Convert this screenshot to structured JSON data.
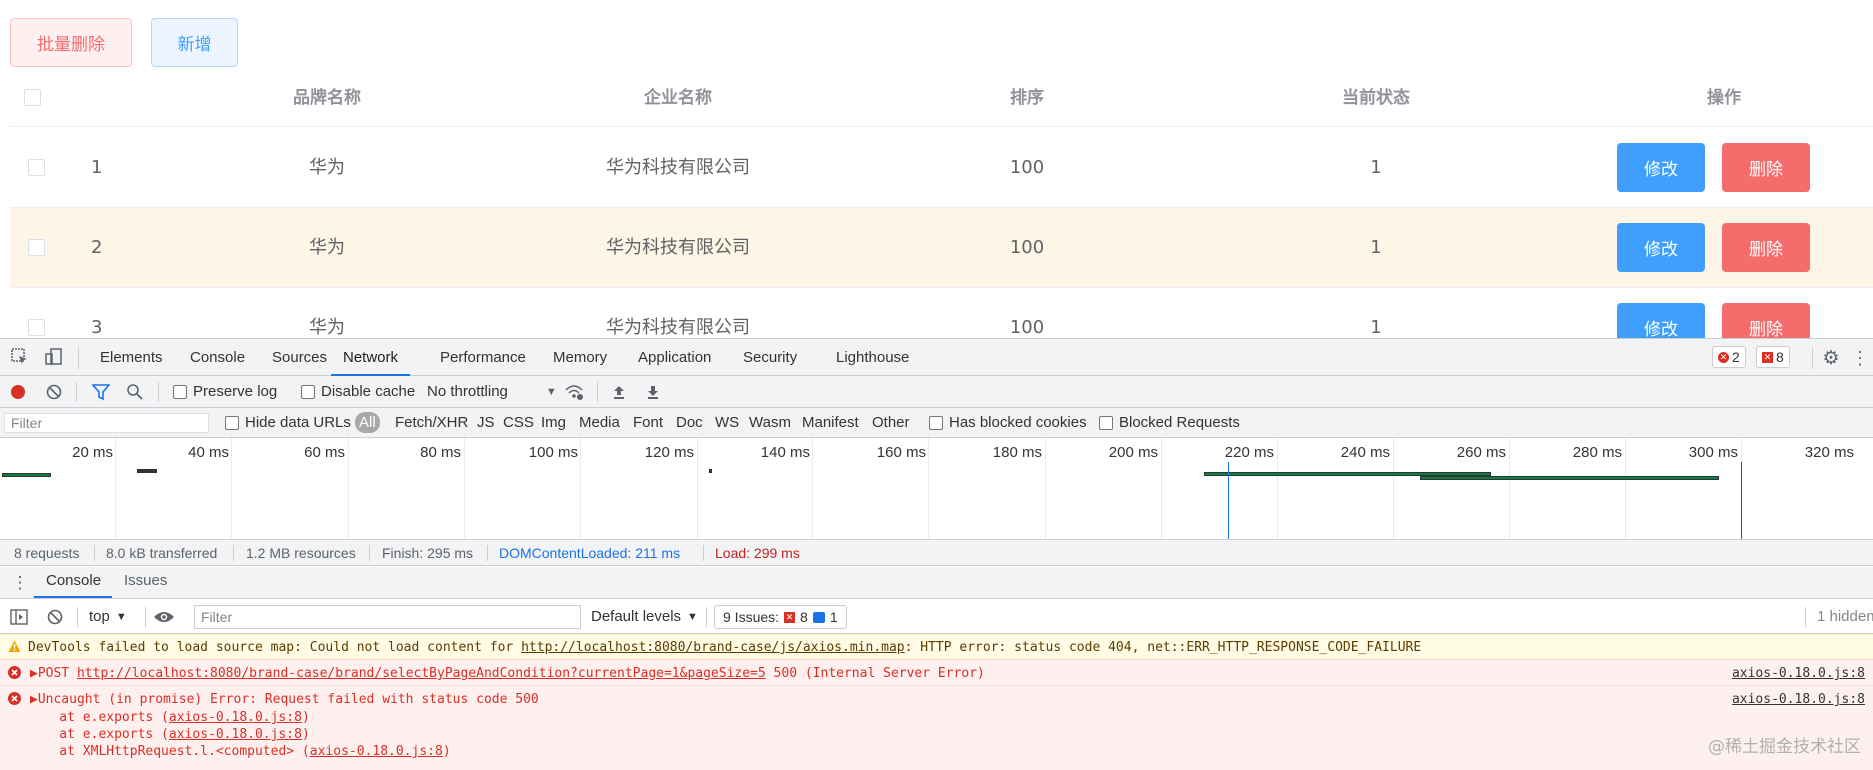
{
  "app": {
    "batch_delete": "批量删除",
    "add": "新增",
    "columns": [
      "品牌名称",
      "企业名称",
      "排序",
      "当前状态",
      "操作"
    ],
    "rows": [
      {
        "index": "1",
        "brand": "华为",
        "company": "华为科技有限公司",
        "order": "100",
        "status": "1"
      },
      {
        "index": "2",
        "brand": "华为",
        "company": "华为科技有限公司",
        "order": "100",
        "status": "1"
      },
      {
        "index": "3",
        "brand": "华为",
        "company": "华为科技有限公司",
        "order": "100",
        "status": "1"
      }
    ],
    "edit_label": "修改",
    "delete_label": "删除"
  },
  "devtools": {
    "tabs": [
      "Elements",
      "Console",
      "Sources",
      "Network",
      "Performance",
      "Memory",
      "Application",
      "Security",
      "Lighthouse"
    ],
    "active_tab": "Network",
    "error_count": "2",
    "issue_count": "8",
    "network_toolbar": {
      "preserve_log": "Preserve log",
      "disable_cache": "Disable cache",
      "throttling": "No throttling"
    },
    "filter_bar": {
      "placeholder": "Filter",
      "hide_data_urls": "Hide data URLs",
      "types": [
        "All",
        "Fetch/XHR",
        "JS",
        "CSS",
        "Img",
        "Media",
        "Font",
        "Doc",
        "WS",
        "Wasm",
        "Manifest",
        "Other"
      ],
      "blocked_cookies": "Has blocked cookies",
      "blocked_requests": "Blocked Requests"
    },
    "timeline_labels": [
      "20 ms",
      "40 ms",
      "60 ms",
      "80 ms",
      "100 ms",
      "120 ms",
      "140 ms",
      "160 ms",
      "180 ms",
      "200 ms",
      "220 ms",
      "240 ms",
      "260 ms",
      "280 ms",
      "300 ms",
      "320 ms"
    ],
    "summary": {
      "requests": "8 requests",
      "transferred": "8.0 kB transferred",
      "resources": "1.2 MB resources",
      "finish": "Finish: 295 ms",
      "dom_loaded": "DOMContentLoaded: 211 ms",
      "load": "Load: 299 ms"
    },
    "drawer_tabs": [
      "Console",
      "Issues"
    ],
    "console_toolbar": {
      "context": "top",
      "filter_placeholder": "Filter",
      "levels": "Default levels",
      "issues_label": "9 Issues:",
      "issues_errors": "8",
      "issues_info": "1",
      "hidden": "1 hidden"
    },
    "messages": {
      "warn_prefix": "DevTools failed to load source map: Could not load content for ",
      "warn_url": "http://localhost:8080/brand-case/js/axios.min.map",
      "warn_suffix": ": HTTP error: status code 404, net::ERR_HTTP_RESPONSE_CODE_FAILURE",
      "err1_method": "POST ",
      "err1_url": "http://localhost:8080/brand-case/brand/selectByPageAndCondition?currentPage=1&pageSize=5",
      "err1_suffix": " 500 (Internal Server Error)",
      "err1_src": "axios-0.18.0.js:8",
      "err2_text": "Uncaught (in promise) Error: Request failed with status code 500",
      "err2_src": "axios-0.18.0.js:8",
      "stack": [
        {
          "prefix": "    at e.exports (",
          "link": "axios-0.18.0.js:8",
          "suffix": ")"
        },
        {
          "prefix": "    at e.exports (",
          "link": "axios-0.18.0.js:8",
          "suffix": ")"
        },
        {
          "prefix": "    at XMLHttpRequest.l.<computed> (",
          "link": "axios-0.18.0.js:8",
          "suffix": ")"
        }
      ]
    },
    "watermark": "@稀土掘金技术社区"
  },
  "colors": {
    "primary": "#409eff",
    "danger": "#f56c6c",
    "highlight_row": "#fdf5e6",
    "devtools_accent": "#1a73e8",
    "error": "#d93025"
  }
}
